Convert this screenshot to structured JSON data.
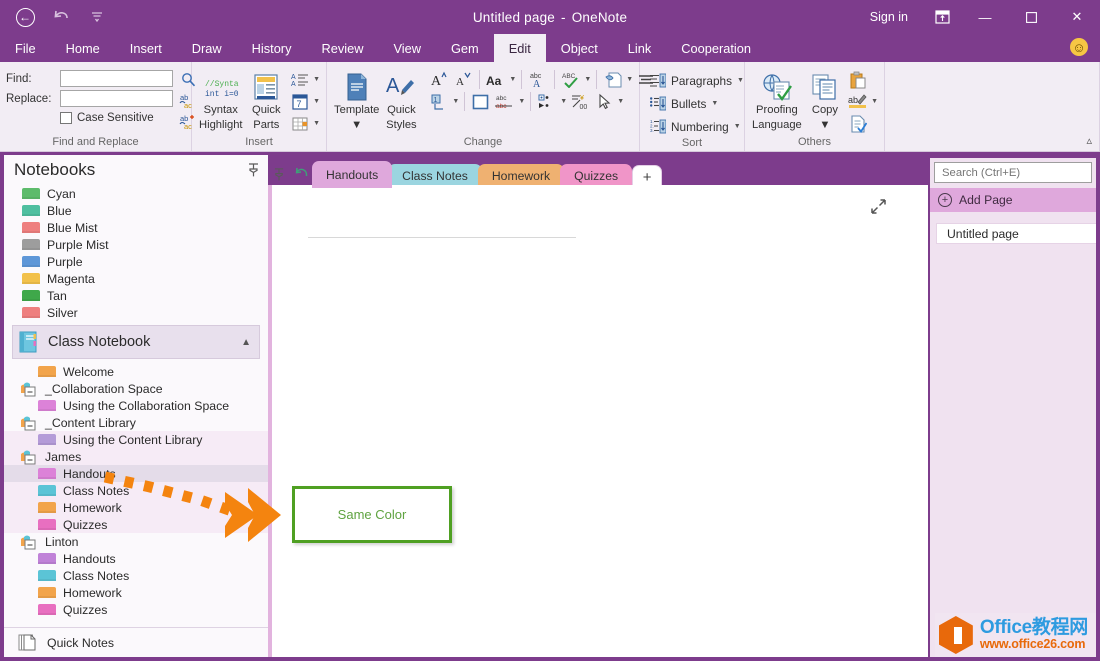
{
  "titlebar": {
    "back_icon": "back-arrow-icon",
    "undo_icon": "undo-icon",
    "qat_more_icon": "quick-access-more-icon",
    "title": "Untitled page",
    "title_sep": "-",
    "app_name": "OneNote",
    "signin": "Sign in",
    "ribbon_display_icon": "ribbon-display-options-icon",
    "minimize": "—",
    "maximize": "☐",
    "close": "✕"
  },
  "menubar": {
    "items": [
      {
        "label": "File",
        "active": false
      },
      {
        "label": "Home",
        "active": false
      },
      {
        "label": "Insert",
        "active": false
      },
      {
        "label": "Draw",
        "active": false
      },
      {
        "label": "History",
        "active": false
      },
      {
        "label": "Review",
        "active": false
      },
      {
        "label": "View",
        "active": false
      },
      {
        "label": "Gem",
        "active": false
      },
      {
        "label": "Edit",
        "active": true
      },
      {
        "label": "Object",
        "active": false
      },
      {
        "label": "Link",
        "active": false
      },
      {
        "label": "Cooperation",
        "active": false
      }
    ],
    "smiley": "☺"
  },
  "ribbon": {
    "groups": [
      {
        "label": "Find and Replace"
      },
      {
        "label": "Insert"
      },
      {
        "label": "Change"
      },
      {
        "label": "Sort"
      },
      {
        "label": "Others"
      }
    ],
    "find": {
      "find_label": "Find:",
      "find_value": "",
      "find_placeholder": "",
      "replace_label": "Replace:",
      "replace_value": "",
      "replace_placeholder": "",
      "case_sensitive_label": "Case Sensitive",
      "case_sensitive_checked": false,
      "icons": [
        "search-icon",
        "replace-icon",
        "replace-all-icon"
      ]
    },
    "insert": {
      "syntax_highlight": "Syntax\nHighlight",
      "syntax_highlight_l1": "Syntax",
      "syntax_highlight_l2": "Highlight",
      "quick_parts_l1": "Quick",
      "quick_parts_l2": "Parts",
      "template_label": "Template",
      "quick_styles_l1": "Quick",
      "quick_styles_l2": "Styles",
      "small_icons": [
        "align-text-icon",
        "date-icon",
        "table-icon"
      ]
    },
    "change": {
      "icons": [
        "grow-font-icon",
        "shrink-font-icon",
        "change-case-icon",
        "superscript-icon",
        "spelling-check-icon",
        "text-highlight-icon",
        "align-icon",
        "indent-icon",
        "border-icon",
        "strikethrough-icon",
        "bullet-list-icon",
        "number-format-icon",
        "select-cursor-icon"
      ]
    },
    "sort": {
      "items": [
        {
          "label": "Paragraphs",
          "icon": "sort-paragraphs-icon"
        },
        {
          "label": "Bullets",
          "icon": "sort-bullets-icon"
        },
        {
          "label": "Numbering",
          "icon": "sort-numbering-icon"
        }
      ]
    },
    "others": {
      "proofing_l1": "Proofing",
      "proofing_l2": "Language",
      "copy_label": "Copy",
      "small_icons": [
        "paste-icon",
        "highlight-pen-icon",
        "document-check-icon"
      ]
    },
    "collapse_icon": "collapse-ribbon-icon"
  },
  "nav": {
    "title": "Notebooks",
    "pin_icon": "pin-icon",
    "notebooks": [
      {
        "label": "Cyan",
        "color": "#5DBB6B"
      },
      {
        "label": "Blue",
        "color": "#4FBFA0"
      },
      {
        "label": "Blue Mist",
        "color": "#EE7F7F"
      },
      {
        "label": "Purple Mist",
        "color": "#9D9D9D"
      },
      {
        "label": "Purple",
        "color": "#5E97D8"
      },
      {
        "label": "Magenta",
        "color": "#F2C14B"
      },
      {
        "label": "Tan",
        "color": "#3FA84A"
      },
      {
        "label": "Silver",
        "color": "#EE7F7F"
      }
    ],
    "open_notebook": {
      "label": "Class Notebook",
      "icon": "notebook-icon",
      "chevron": "⌃"
    },
    "sections": [
      {
        "label": "Welcome",
        "type": "section",
        "color": "#F2A44B",
        "indent": 0,
        "state": ""
      },
      {
        "label": "_Collaboration Space",
        "type": "group",
        "indent": 0,
        "state": ""
      },
      {
        "label": "Using the Collaboration Space",
        "type": "section",
        "color": "#DC82D8",
        "indent": 1,
        "state": ""
      },
      {
        "label": "_Content Library",
        "type": "group",
        "indent": 0,
        "state": ""
      },
      {
        "label": "Using the Content Library",
        "type": "section",
        "color": "#B49BD8",
        "indent": 1,
        "state": "highlight"
      },
      {
        "label": "James",
        "type": "group",
        "indent": 0,
        "state": "highlight"
      },
      {
        "label": "Handouts",
        "type": "section",
        "color": "#DC82D8",
        "indent": 1,
        "state": "selected"
      },
      {
        "label": "Class Notes",
        "type": "section",
        "color": "#5BC4D6",
        "indent": 1,
        "state": "highlight"
      },
      {
        "label": "Homework",
        "type": "section",
        "color": "#F2A44B",
        "indent": 1,
        "state": "highlight"
      },
      {
        "label": "Quizzes",
        "type": "section",
        "color": "#E86FC0",
        "indent": 1,
        "state": "highlight"
      },
      {
        "label": "Linton",
        "type": "group",
        "indent": 0,
        "state": ""
      },
      {
        "label": "Handouts",
        "type": "section",
        "color": "#C082D8",
        "indent": 1,
        "state": ""
      },
      {
        "label": "Class Notes",
        "type": "section",
        "color": "#5BC4D6",
        "indent": 1,
        "state": ""
      },
      {
        "label": "Homework",
        "type": "section",
        "color": "#F2A44B",
        "indent": 1,
        "state": ""
      },
      {
        "label": "Quizzes",
        "type": "section",
        "color": "#E86FC0",
        "indent": 1,
        "state": ""
      }
    ],
    "quick_notes": {
      "label": "Quick Notes",
      "icon": "quick-notes-icon"
    }
  },
  "tabstrip": {
    "pin_icon": "pin-tabs-icon",
    "back_icon": "navigate-back-icon",
    "tabs": [
      {
        "label": "Handouts",
        "color": "#DFA8DC",
        "active": true
      },
      {
        "label": "Class Notes",
        "color": "#9BD5E0",
        "active": false
      },
      {
        "label": "Homework",
        "color": "#EFB171",
        "active": false
      },
      {
        "label": "Quizzes",
        "color": "#F095C8",
        "active": false
      }
    ],
    "add_label": "+"
  },
  "canvas": {
    "expand_icon": "expand-page-icon",
    "note_box_text": "Same Color",
    "note_box_border_color": "#4FA022",
    "note_box_text_color": "#5FA340",
    "arrow_color": "#F4840F",
    "arrow_icon": "dashed-arrow-icon"
  },
  "pagepane": {
    "search_placeholder": "Search (Ctrl+E)",
    "search_value": "",
    "search_icon": "search-icon",
    "search_caret_icon": "chevron-down-icon",
    "add_page_label": "Add Page",
    "add_page_icon": "plus-circle-icon",
    "pages": [
      {
        "label": "Untitled page",
        "selected": true
      }
    ]
  },
  "watermark": {
    "line1": "Office教程网",
    "line2": "www.office26.com",
    "logo_icon": "office-hex-logo-icon"
  }
}
